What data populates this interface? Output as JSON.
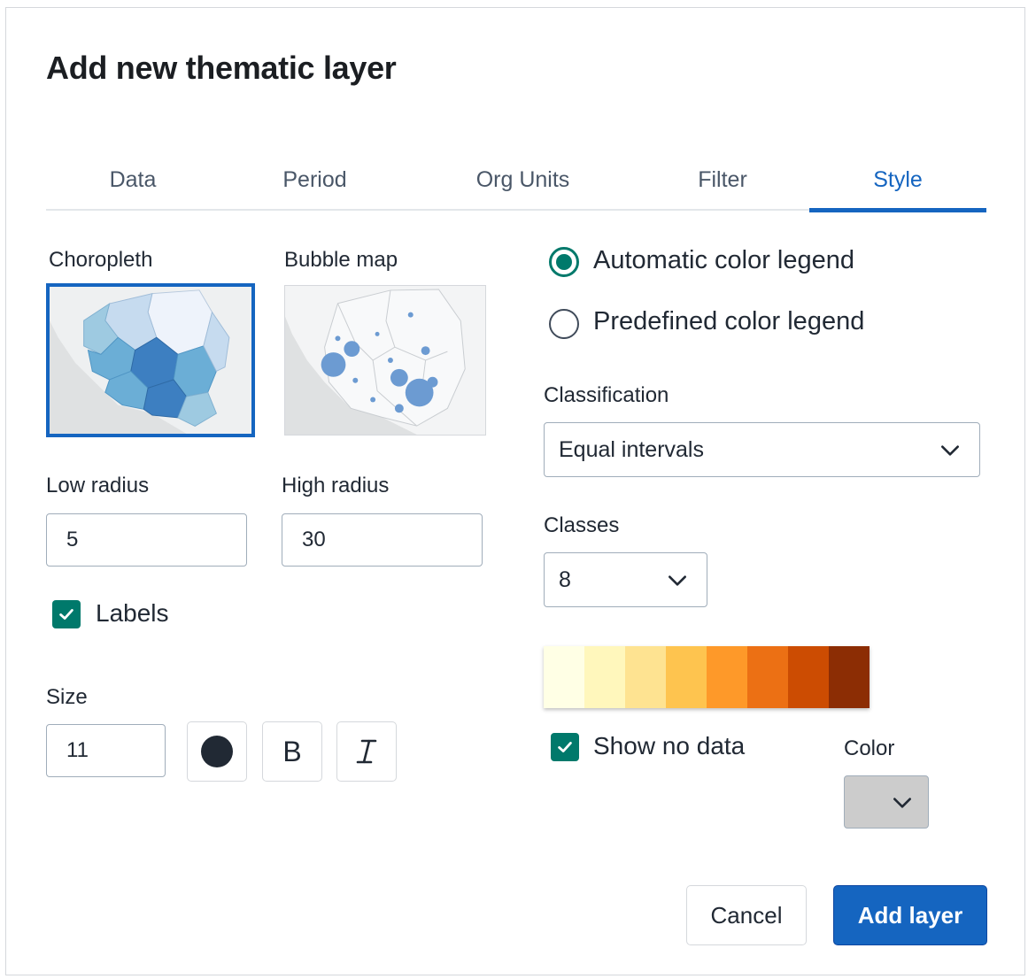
{
  "dialog": {
    "title": "Add new thematic layer"
  },
  "tabs": [
    {
      "label": "Data",
      "active": false
    },
    {
      "label": "Period",
      "active": false
    },
    {
      "label": "Org Units",
      "active": false
    },
    {
      "label": "Filter",
      "active": false
    },
    {
      "label": "Style",
      "active": true
    }
  ],
  "style": {
    "choropleth_label": "Choropleth",
    "bubble_label": "Bubble map",
    "selected_type": "Choropleth",
    "low_radius_label": "Low radius",
    "low_radius_value": "5",
    "high_radius_label": "High radius",
    "high_radius_value": "30",
    "labels_checkbox": {
      "label": "Labels",
      "checked": true
    },
    "size_label": "Size",
    "size_value": "11",
    "font_color_icon": "filled-circle-icon",
    "bold_label": "B",
    "italic_label": "I"
  },
  "legend": {
    "automatic_label": "Automatic color legend",
    "predefined_label": "Predefined color legend",
    "selected": "automatic",
    "classification_label": "Classification",
    "classification_value": "Equal intervals",
    "classes_label": "Classes",
    "classes_value": "8",
    "ramp_colors": [
      "#ffffe5",
      "#fff7bc",
      "#fee391",
      "#fec44f",
      "#fe9929",
      "#ec7014",
      "#cc4c02",
      "#8c2d04"
    ],
    "show_no_data": {
      "label": "Show no data",
      "checked": true
    },
    "color_label": "Color",
    "no_data_color": "#cccccc"
  },
  "actions": {
    "cancel_label": "Cancel",
    "add_label": "Add layer"
  },
  "colors": {
    "accent": "#1565c0",
    "check": "#00796b"
  }
}
